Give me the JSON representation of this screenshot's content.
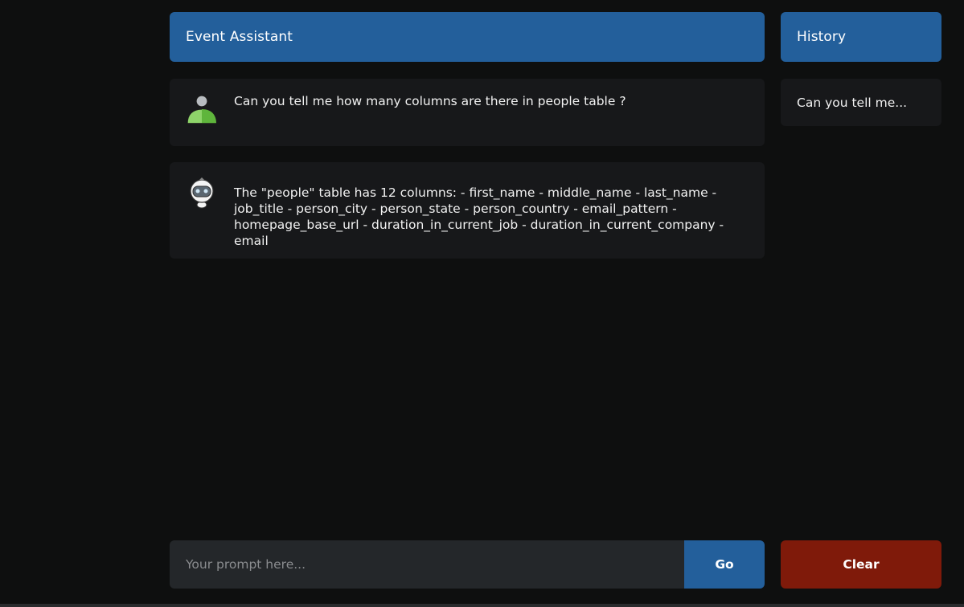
{
  "header": {
    "title": "Event Assistant"
  },
  "history": {
    "title": "History",
    "items": [
      {
        "label": "Can you tell me..."
      }
    ]
  },
  "messages": [
    {
      "role": "user",
      "avatar_icon": "user-avatar-icon",
      "text": "Can you tell me how many columns are there in people table ?"
    },
    {
      "role": "assistant",
      "avatar_icon": "robot-avatar-icon",
      "text": "The \"people\" table has 12 columns: - first_name - middle_name - last_name - job_title - person_city - person_state - person_country - email_pattern - homepage_base_url - duration_in_current_job - duration_in_current_company - email"
    }
  ],
  "prompt": {
    "placeholder": "Your prompt here...",
    "value": "",
    "go_label": "Go",
    "clear_label": "Clear"
  },
  "colors": {
    "background": "#0e0f0f",
    "accent": "#235f9b",
    "panel": "#17181a",
    "input": "#24272a",
    "clear": "#7f1a0a"
  }
}
